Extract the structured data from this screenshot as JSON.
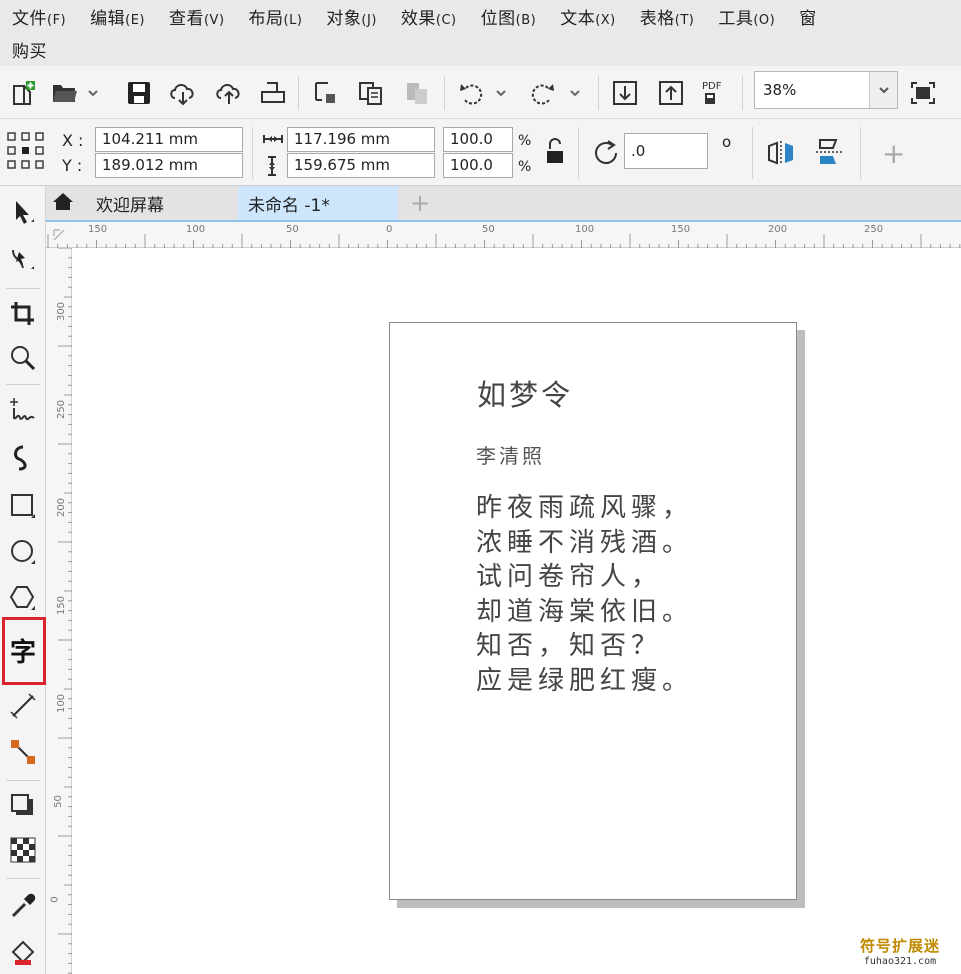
{
  "menu": {
    "items": [
      {
        "label": "文件",
        "accel": "(F)"
      },
      {
        "label": "编辑",
        "accel": "(E)"
      },
      {
        "label": "查看",
        "accel": "(V)"
      },
      {
        "label": "布局",
        "accel": "(L)"
      },
      {
        "label": "对象",
        "accel": "(J)"
      },
      {
        "label": "效果",
        "accel": "(C)"
      },
      {
        "label": "位图",
        "accel": "(B)"
      },
      {
        "label": "文本",
        "accel": "(X)"
      },
      {
        "label": "表格",
        "accel": "(T)"
      },
      {
        "label": "工具",
        "accel": "(O)"
      },
      {
        "label": "窗",
        "accel": ""
      }
    ],
    "second_row": "购买"
  },
  "toolbar": {
    "zoom": "38%",
    "pdf_label": "PDF"
  },
  "propbar": {
    "x_label": "X :",
    "y_label": "Y :",
    "x_value": "104.211 mm",
    "y_value": "189.012 mm",
    "width_value": "117.196 mm",
    "height_value": "159.675 mm",
    "scale_w": "100.0",
    "scale_h": "100.0",
    "pct": "%",
    "rotation": ".0",
    "degree": "o"
  },
  "tabs": {
    "welcome": "欢迎屏幕",
    "document": "未命名 -1*"
  },
  "ruler": {
    "h_ticks": [
      "150",
      "100",
      "50",
      "0",
      "50",
      "100",
      "150",
      "200",
      "250"
    ],
    "v_ticks": [
      "300",
      "250",
      "200",
      "150",
      "100",
      "50",
      "0"
    ]
  },
  "poem": {
    "title": "如梦令",
    "author": "李清照",
    "lines": [
      "昨夜雨疏风骤，",
      "浓睡不消残酒。",
      "试问卷帘人，",
      "却道海棠依旧。",
      "知否，知否？",
      "应是绿肥红瘦。"
    ]
  },
  "text_tool_glyph": "字",
  "watermark": {
    "name": "符号扩展迷",
    "url": "fuhao321.com"
  }
}
